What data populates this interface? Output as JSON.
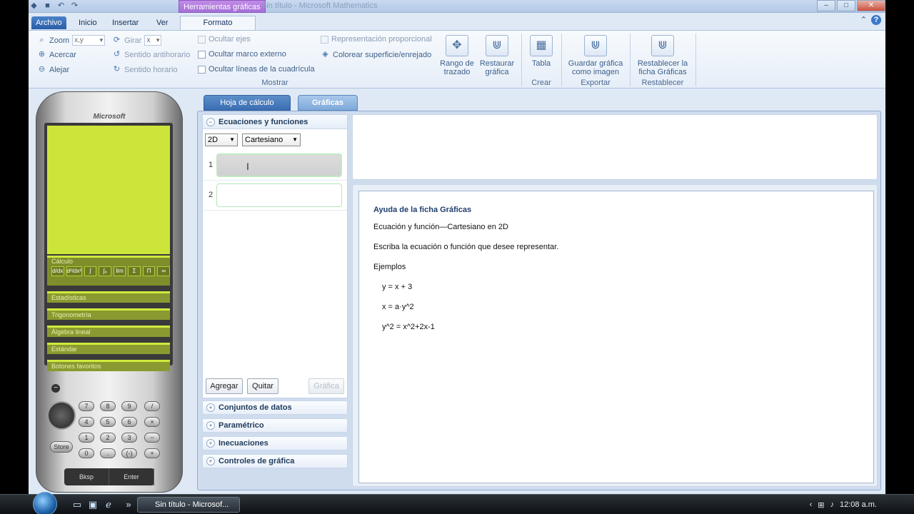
{
  "titlebar": {
    "context_tool": "Herramientas gráficas",
    "window_title": "Sin título - Microsoft Mathematics"
  },
  "tabs": {
    "file": "Archivo",
    "home": "Inicio",
    "insert": "Insertar",
    "view": "Ver",
    "format": "Formato"
  },
  "ribbon": {
    "zoom_label": "Zoom",
    "zoom_value": "x,y",
    "acercar": "Acercar",
    "alejar": "Alejar",
    "girar_label": "Girar",
    "girar_value": "x",
    "antihorario": "Sentido antihorario",
    "horario": "Sentido horario",
    "ocultar_ejes": "Ocultar ejes",
    "ocultar_marco": "Ocultar marco externo",
    "ocultar_lineas": "Ocultar líneas de la cuadrícula",
    "mostrar_group": "Mostrar",
    "proporcional": "Representación proporcional",
    "colorear": "Colorear superficie/enrejado",
    "rango": "Rango de trazado",
    "restaurar": "Restaurar gráfica",
    "tabla": "Tabla",
    "crear_group": "Crear",
    "guardar": "Guardar gráfica como imagen",
    "exportar_group": "Exportar",
    "restablecer": "Restablecer la ficha Gráficas",
    "restablecer_group": "Restablecer"
  },
  "calculator": {
    "brand": "Microsoft",
    "calculo": "Cálculo",
    "fn_keys": [
      "d/dx",
      "d²/dx²",
      "∫",
      "∫ₐ",
      "lim",
      "Σ",
      "Π",
      "∞"
    ],
    "categories": [
      "Estadísticas",
      "Trigonometría",
      "Álgebra lineal",
      "Estándar",
      "Botones favoritos"
    ],
    "keys_row1": [
      "7",
      "8",
      "9",
      "/"
    ],
    "keys_row2": [
      "4",
      "5",
      "6",
      "×"
    ],
    "keys_row3": [
      "1",
      "2",
      "3",
      "−"
    ],
    "keys_row4": [
      "0",
      ".",
      "(-)",
      "+"
    ],
    "store": "Store",
    "bksp": "Bksp",
    "enter": "Enter"
  },
  "main": {
    "tab_sheet": "Hoja de cálculo",
    "tab_graph": "Gráficas",
    "eq_header": "Ecuaciones y funciones",
    "dim_select": "2D",
    "coord_select": "Cartesiano",
    "eq_num_1": "1",
    "eq_num_2": "2",
    "agregar": "Agregar",
    "quitar": "Quitar",
    "grafica": "Gráfica",
    "sections": [
      "Conjuntos de datos",
      "Paramétrico",
      "Inecuaciones",
      "Controles de gráfica"
    ]
  },
  "help": {
    "title": "Ayuda de la ficha Gráficas",
    "line1": "Ecuación y función—Cartesiano en 2D",
    "line2": "Escriba la ecuación o función que desee representar.",
    "examples": "Ejemplos",
    "ex1": "y = x + 3",
    "ex2": "x = a·y^2",
    "ex3": "y^2 = x^2+2x-1"
  },
  "taskbar": {
    "task": "Sin título - Microsof...",
    "clock": "12:08 a.m."
  }
}
